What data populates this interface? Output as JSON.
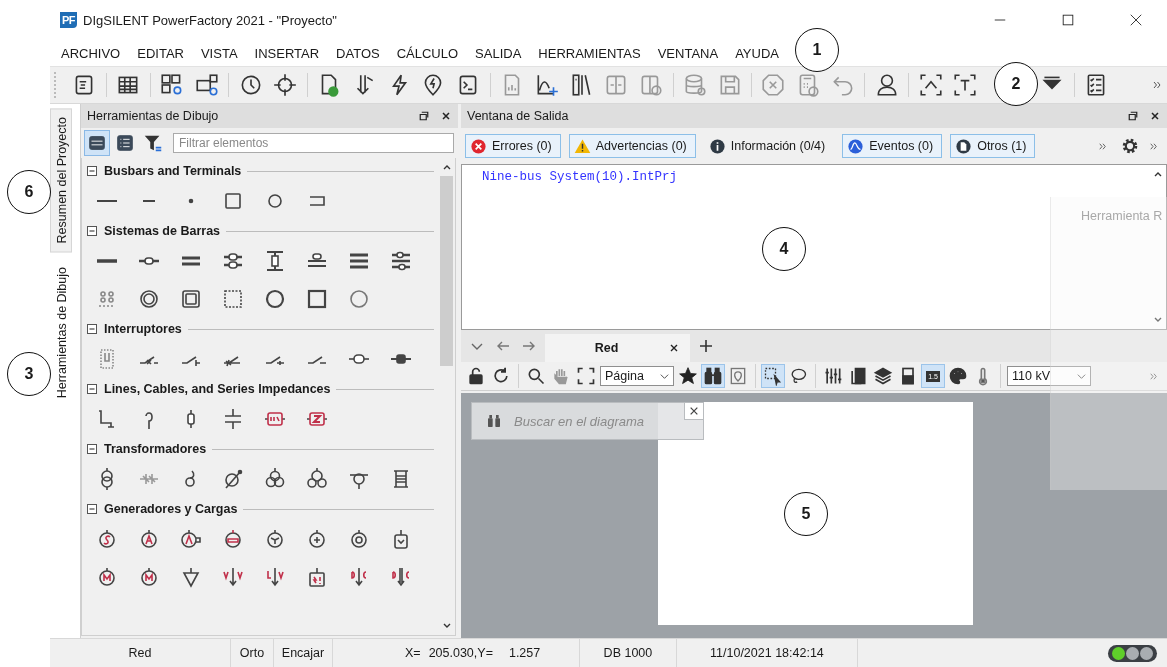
{
  "window": {
    "logo": "PF",
    "title": "DIgSILENT PowerFactory 2021 - \"Proyecto\""
  },
  "menu": [
    "ARCHIVO",
    "EDITAR",
    "VISTA",
    "INSERTAR",
    "DATOS",
    "CÁLCULO",
    "SALIDA",
    "HERRAMIENTAS",
    "VENTANA",
    "AYUDA"
  ],
  "side_tabs": [
    {
      "label": "Resumen del Proyecto",
      "selected": false
    },
    {
      "label": "Herramientas de Dibujo",
      "selected": true
    }
  ],
  "drawing_tools": {
    "title": "Herramientas de Dibujo",
    "view_modes": [
      {
        "kind": "icons",
        "selected": true
      },
      {
        "kind": "list",
        "selected": false
      }
    ],
    "filter": {
      "placeholder": "Filtrar elementos"
    },
    "sections": [
      {
        "title": "Busbars and Terminals",
        "expanded": true
      },
      {
        "title": "Sistemas de Barras",
        "expanded": true
      },
      {
        "title": "Interruptores",
        "expanded": true
      },
      {
        "title": "Lines, Cables, and Series Impedances",
        "expanded": true
      },
      {
        "title": "Transformadores",
        "expanded": true
      },
      {
        "title": "Generadores y Cargas",
        "expanded": true
      }
    ]
  },
  "output": {
    "title": "Ventana de Salida",
    "filters": [
      {
        "kind": "error",
        "label": "Errores (0)",
        "selected": true
      },
      {
        "kind": "warning",
        "label": "Advertencias (0)",
        "selected": true
      },
      {
        "kind": "info",
        "label": "Información (0/4)",
        "selected": false
      },
      {
        "kind": "events",
        "label": "Eventos (0)",
        "selected": true
      },
      {
        "kind": "other",
        "label": "Otros (1)",
        "selected": true
      }
    ],
    "lines": [
      "Nine-bus System(10).IntPrj"
    ]
  },
  "floating_panel": {
    "title": "Herramienta R"
  },
  "diagram": {
    "tabs": [
      {
        "label": "Red",
        "selected": true
      }
    ],
    "zoom_select": "Página",
    "find_active": true,
    "rect_select_active": true,
    "scale_label": "1.5",
    "scale_active": true,
    "voltage_select": "110 kV",
    "search": {
      "placeholder": "Buscar en el diagrama"
    }
  },
  "status_bar": {
    "view": "Red",
    "ortho": "Orto",
    "snap": "Encajar",
    "x_label": "X=",
    "x_value": "205.030,Y=",
    "y_value": "1.257",
    "database": "DB 1000",
    "timestamp": "11/10/2021 18:42:14",
    "indicators": [
      {
        "color": "#5fce2a"
      },
      {
        "color": "#a9adb1"
      },
      {
        "color": "#a9adb1"
      }
    ]
  },
  "callouts": [
    "1",
    "2",
    "3",
    "4",
    "5",
    "6"
  ]
}
